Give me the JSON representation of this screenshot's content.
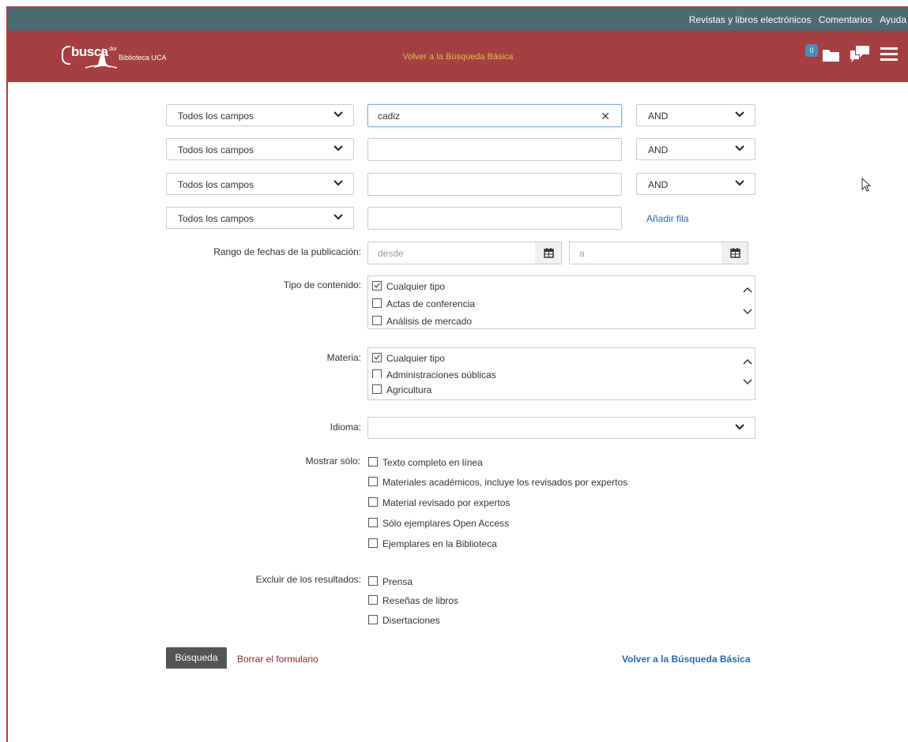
{
  "topbar": {
    "links": [
      "Revistas y libros electrónicos",
      "Comentarios",
      "Ayuda"
    ]
  },
  "header": {
    "logo_word": "busca",
    "logo_suffix": "dor",
    "logo_subtitle": "Biblioteca UCA",
    "center_link": "Volver a la Búsqueda Básica",
    "folder_count": "0"
  },
  "search_rows": [
    {
      "field": "Todos los campos",
      "value": "cadiz",
      "operator": "AND"
    },
    {
      "field": "Todos los campos",
      "value": "",
      "operator": "AND"
    },
    {
      "field": "Todos los campos",
      "value": "",
      "operator": "AND"
    },
    {
      "field": "Todos los campos",
      "value": ""
    }
  ],
  "add_row_label": "Añadir fila",
  "date_range": {
    "label": "Rango de fechas de la publicación:",
    "from_placeholder": "desde",
    "to_placeholder": "a"
  },
  "content_type": {
    "label": "Tipo de contenido:",
    "items": [
      {
        "label": "Cualquier tipo",
        "checked": true
      },
      {
        "label": "Actas de conferencia",
        "checked": false
      },
      {
        "label": "Análisis de mercado",
        "checked": false
      }
    ]
  },
  "subject": {
    "label": "Materia:",
    "items": [
      {
        "label": "Cualquier tipo",
        "checked": true
      },
      {
        "label": "Administraciones públicas",
        "checked": false
      },
      {
        "label": "Agricultura",
        "checked": false
      }
    ]
  },
  "language": {
    "label": "Idioma:",
    "value": ""
  },
  "show_only": {
    "label": "Mostrar sólo:",
    "options": [
      "Texto completo en línea",
      "Materiales académicos, incluye los revisados por expertos",
      "Material revisado por expertos",
      "Sólo ejemplares Open Access",
      "Ejemplares en la Biblioteca"
    ]
  },
  "exclude": {
    "label": "Excluir de los resultados:",
    "options": [
      "Prensa",
      "Reseñas de libros",
      "Disertaciones"
    ]
  },
  "actions": {
    "search_label": "Búsqueda",
    "clear_label": "Borrar el formulario",
    "back_label": "Volver a la Búsqueda Básica"
  },
  "colors": {
    "topbar": "#4e6a73",
    "header": "#a53f41",
    "link": "#2a6aa8",
    "button": "#555555"
  }
}
